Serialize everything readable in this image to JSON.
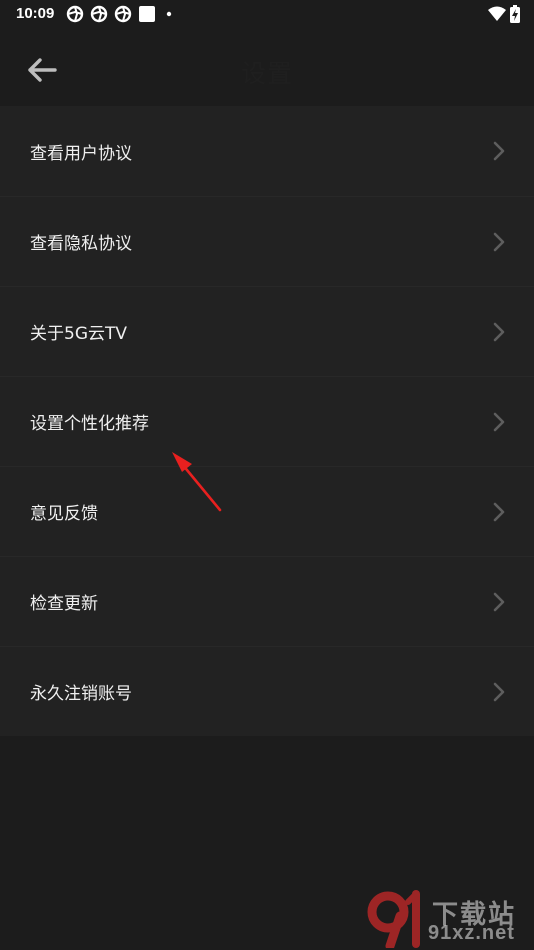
{
  "status_bar": {
    "time": "10:09",
    "left_icons": [
      "app-notification-icon",
      "app-notification-icon",
      "app-notification-icon",
      "square-notification-icon",
      "dot-icon"
    ],
    "right_icons": [
      "wifi-icon",
      "battery-charging-icon"
    ]
  },
  "header": {
    "back_icon": "arrow-left-icon",
    "title": "设置"
  },
  "settings": {
    "items": [
      {
        "label": "查看用户协议"
      },
      {
        "label": "查看隐私协议"
      },
      {
        "label": "关于5G云TV"
      },
      {
        "label": "设置个性化推荐"
      },
      {
        "label": "意见反馈"
      },
      {
        "label": "检查更新"
      },
      {
        "label": "永久注销账号"
      }
    ]
  },
  "annotation": {
    "color": "#e8201f"
  },
  "watermark": {
    "line1": "下载站",
    "line2": "91xz.net",
    "logo_color": "#d42a2a"
  },
  "colors": {
    "background": "#1c1c1c",
    "list_background": "#222222",
    "text": "#f0f0f0",
    "chevron": "#666666"
  }
}
